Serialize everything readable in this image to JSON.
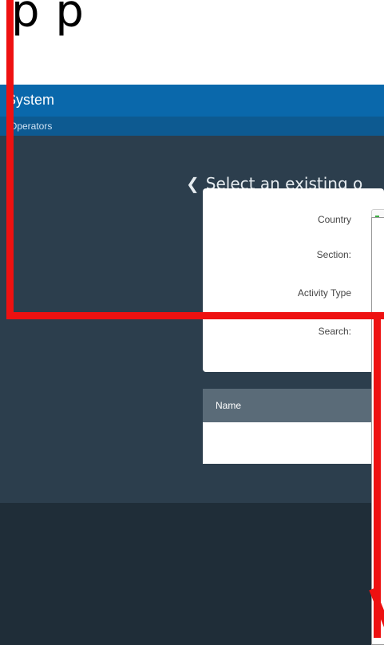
{
  "top_text": "p    p",
  "header": {
    "title": "System"
  },
  "subnav": {
    "label": "Operators"
  },
  "page": {
    "title": "Select an existing o"
  },
  "form": {
    "country_label": "Country",
    "section_label": "Section:",
    "activity_label": "Activity Type",
    "search_label": "Search:"
  },
  "table": {
    "columns": [
      "Name"
    ]
  },
  "colors": {
    "header": "#0a68ab",
    "subnav": "#0d5a91",
    "background": "#2c3e4d",
    "annotation": "#ee1111"
  }
}
